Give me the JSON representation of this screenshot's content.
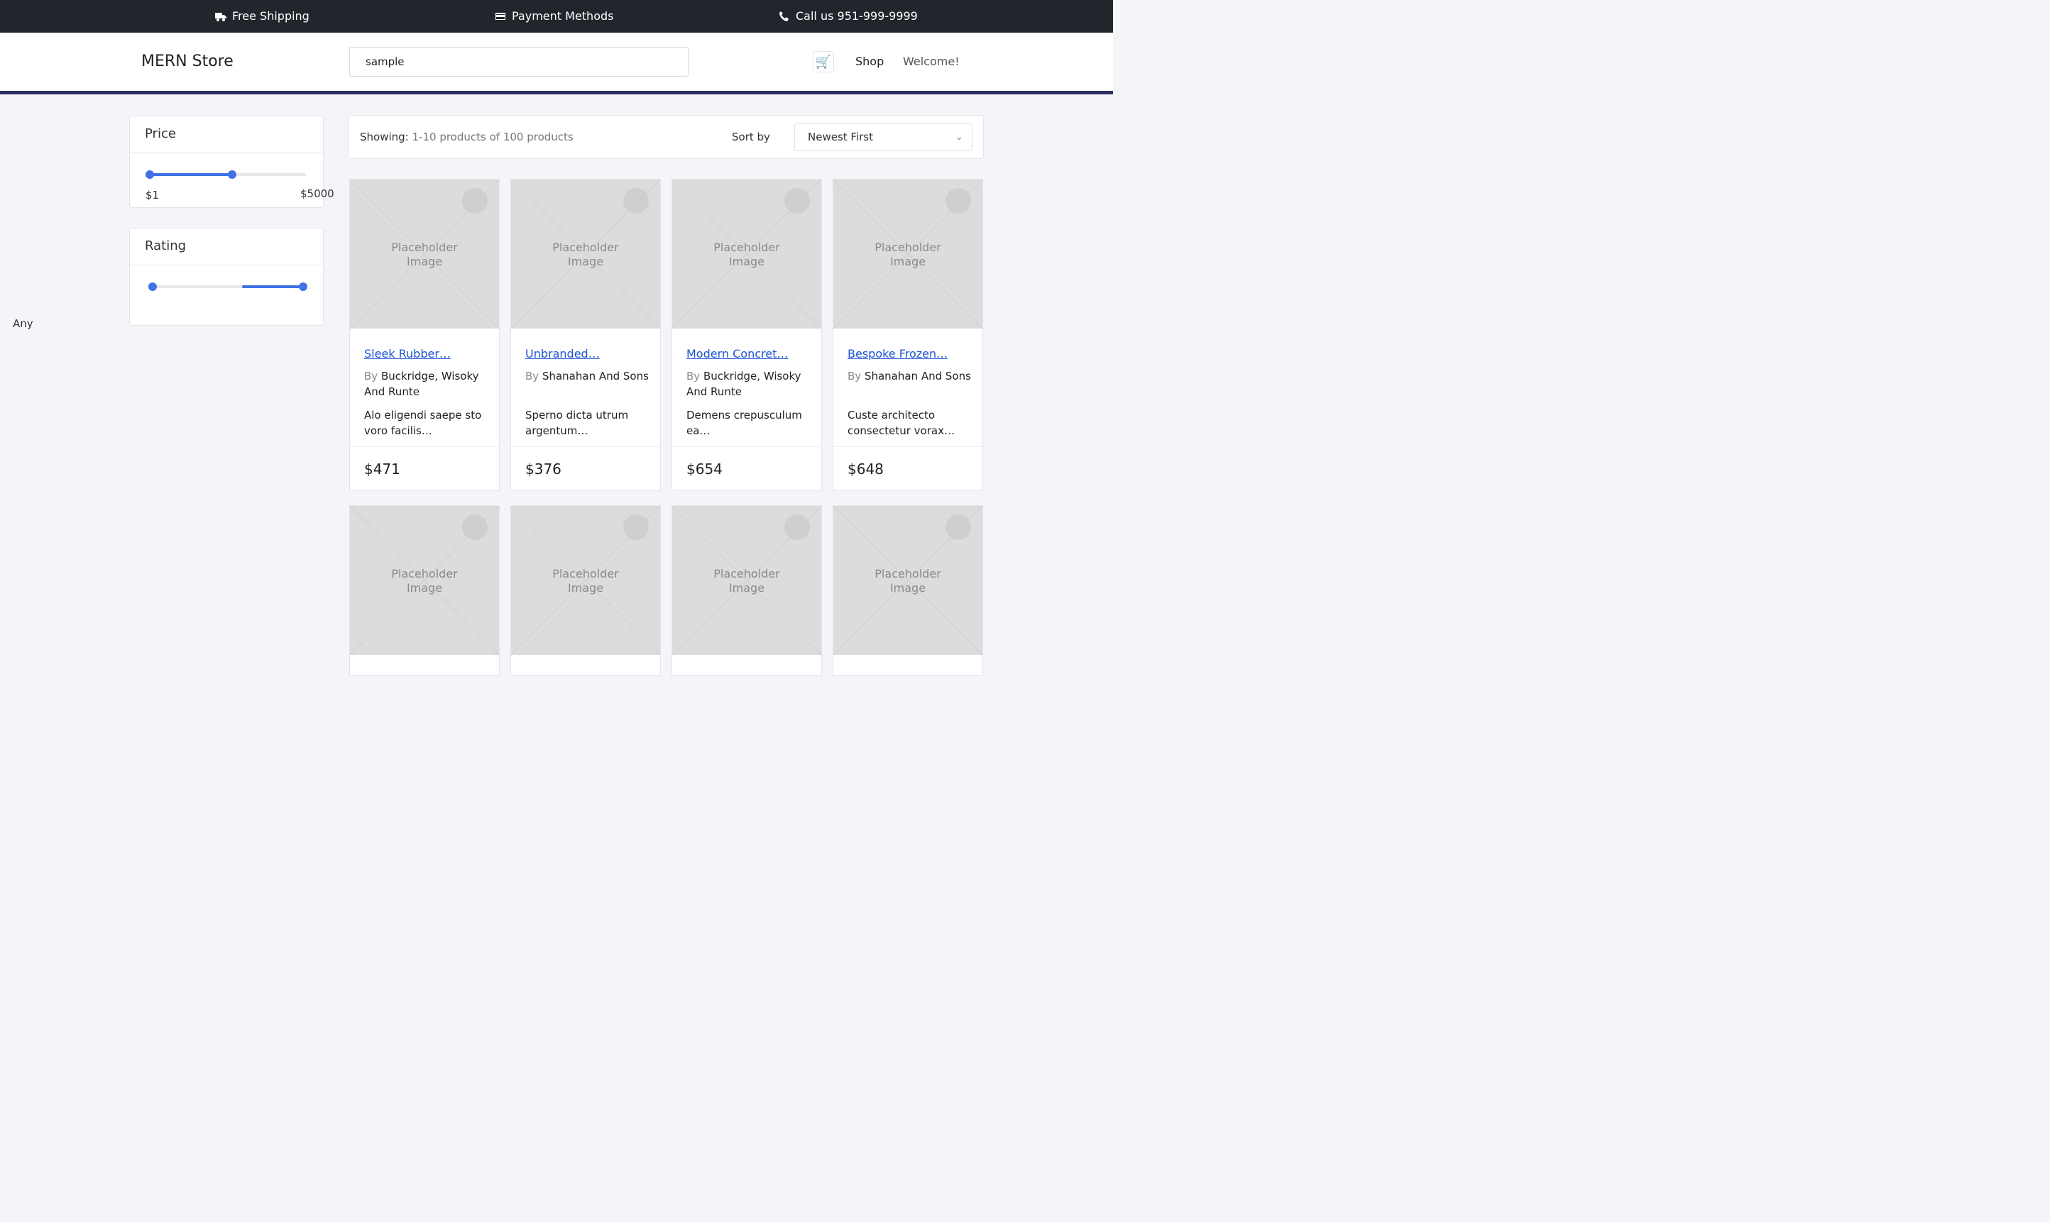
{
  "top_bar": {
    "shipping": "Free Shipping",
    "payment": "Payment Methods",
    "call": "Call us 951-999-9999"
  },
  "header": {
    "logo": "MERN Store",
    "search_value": "sample",
    "shop": "Shop",
    "welcome": "Welcome!"
  },
  "filters": {
    "price_title": "Price",
    "price_min": "$1",
    "price_max": "$5000",
    "rating_title": "Rating",
    "rating_value": "Any"
  },
  "toolbar": {
    "showing_label": "Showing:",
    "showing_text": "1-10 products of 100 products",
    "sort_label": "Sort by",
    "sort_value": "Newest First"
  },
  "placeholder": {
    "line1": "Placeholder",
    "line2": "Image"
  },
  "products": [
    {
      "name": "Sleek Rubber…",
      "by": "By",
      "brand": "Buckridge, Wisoky And Runte",
      "desc": "Alo eligendi saepe sto voro facilis…",
      "price": "$471"
    },
    {
      "name": "Unbranded…",
      "by": "By",
      "brand": "Shanahan And Sons",
      "desc": "Sperno dicta utrum argentum…",
      "price": "$376"
    },
    {
      "name": "Modern Concret…",
      "by": "By",
      "brand": "Buckridge, Wisoky And Runte",
      "desc": "Demens crepusculum ea…",
      "price": "$654"
    },
    {
      "name": "Bespoke Frozen…",
      "by": "By",
      "brand": "Shanahan And Sons",
      "desc": "Custe architecto consectetur vorax…",
      "price": "$648"
    }
  ]
}
